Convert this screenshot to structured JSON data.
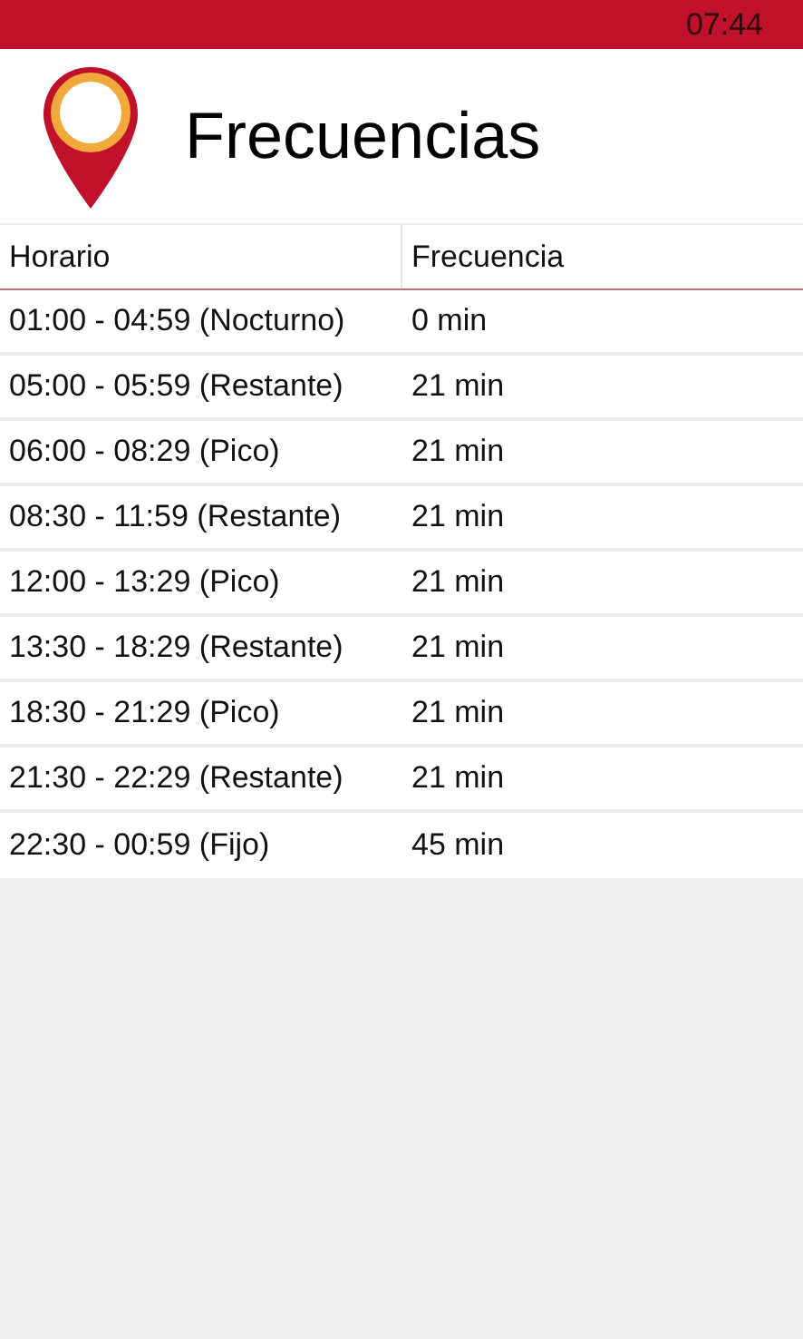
{
  "status_bar": {
    "time": "07:44"
  },
  "header": {
    "title": "Frecuencias"
  },
  "table": {
    "columns": [
      "Horario",
      "Frecuencia"
    ],
    "rows": [
      [
        "01:00 - 04:59 (Nocturno)",
        "0 min"
      ],
      [
        "05:00 - 05:59 (Restante)",
        "21 min"
      ],
      [
        "06:00 - 08:29 (Pico)",
        "21 min"
      ],
      [
        "08:30 - 11:59 (Restante)",
        "21 min"
      ],
      [
        "12:00 - 13:29 (Pico)",
        "21 min"
      ],
      [
        "13:30 - 18:29 (Restante)",
        "21 min"
      ],
      [
        "18:30 - 21:29 (Pico)",
        "21 min"
      ],
      [
        "21:30 - 22:29 (Restante)",
        "21 min"
      ],
      [
        "22:30 - 00:59 (Fijo)",
        "45 min"
      ]
    ]
  }
}
